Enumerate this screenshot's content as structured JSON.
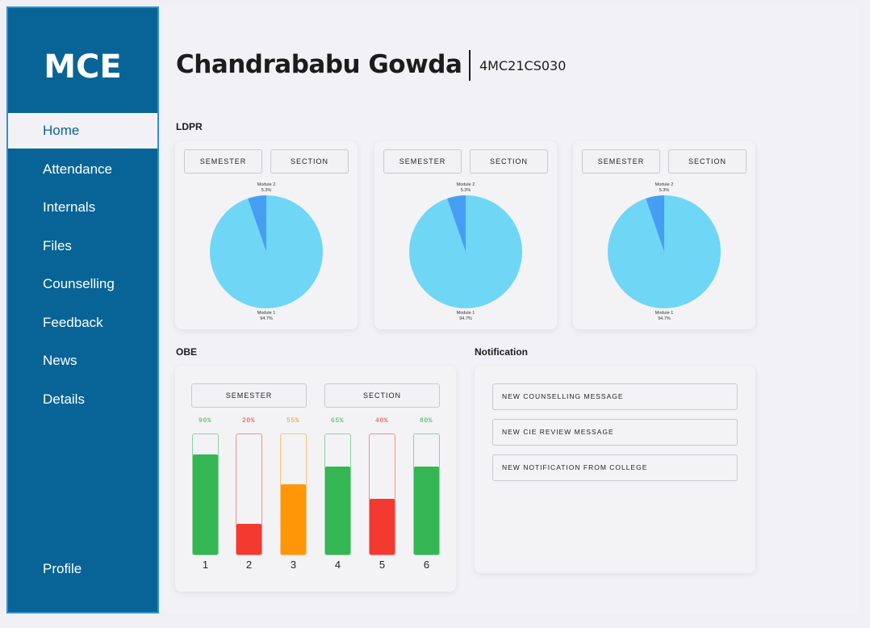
{
  "sidebar": {
    "logo": "MCE",
    "items": [
      {
        "label": "Home",
        "active": true
      },
      {
        "label": "Attendance"
      },
      {
        "label": "Internals"
      },
      {
        "label": "Files"
      },
      {
        "label": "Counselling"
      },
      {
        "label": "Feedback"
      },
      {
        "label": "News"
      },
      {
        "label": "Details"
      }
    ],
    "profile": "Profile"
  },
  "header": {
    "name": "Chandrababu Gowda",
    "usn": "4MC21CS030"
  },
  "ldpr": {
    "title": "LDPR",
    "cards": [
      {
        "semester_label": "SEMESTER",
        "section_label": "SECTION",
        "module1_label": "Module 1",
        "module1_pct": "94.7%",
        "module2_label": "Module 2",
        "module2_pct": "5.3%"
      },
      {
        "semester_label": "SEMESTER",
        "section_label": "SECTION",
        "module1_label": "Module 1",
        "module1_pct": "94.7%",
        "module2_label": "Module 2",
        "module2_pct": "5.3%"
      },
      {
        "semester_label": "SEMESTER",
        "section_label": "SECTION",
        "module1_label": "Module 1",
        "module1_pct": "94.7%",
        "module2_label": "Module 2",
        "module2_pct": "5.3%"
      }
    ]
  },
  "obe": {
    "title": "OBE",
    "semester_label": "SEMESTER",
    "section_label": "SECTION",
    "bars": [
      {
        "pct_label": "90%",
        "value": 0.84,
        "label": "1",
        "color": "#34b752"
      },
      {
        "pct_label": "20%",
        "value": 0.26,
        "label": "2",
        "color": "#f23a30"
      },
      {
        "pct_label": "55%",
        "value": 0.59,
        "label": "3",
        "color": "#ff960a"
      },
      {
        "pct_label": "65%",
        "value": 0.74,
        "label": "4",
        "color": "#34b752"
      },
      {
        "pct_label": "40%",
        "value": 0.47,
        "label": "5",
        "color": "#f23a30"
      },
      {
        "pct_label": "80%",
        "value": 0.74,
        "label": "6",
        "color": "#34b752"
      }
    ]
  },
  "notification": {
    "title": "Notification",
    "items": [
      "NEW COUNSELLING MESSAGE",
      "NEW CIE REVIEW MESSAGE",
      "NEW NOTIFICATION FROM COLLEGE"
    ]
  },
  "colors": {
    "sidebar": "#086496",
    "pie_main": "#70d6f5",
    "pie_slice": "#469ef2"
  }
}
